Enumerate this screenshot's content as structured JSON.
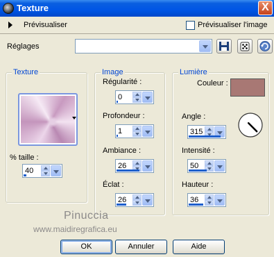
{
  "window": {
    "title": "Texture",
    "close_glyph": "X"
  },
  "preview": {
    "label": "Prévisualiser",
    "apercu_label": "Prévisualiser l'image",
    "apercu_checked": false
  },
  "settings": {
    "label": "Réglages",
    "value": ""
  },
  "texture_group": {
    "title": "Texture",
    "size_label": "% taille :",
    "size_value": "40",
    "size_fraction": 0.08
  },
  "image_group": {
    "title": "Image",
    "fields": [
      {
        "label": "Régularité :",
        "value": "0",
        "fraction": 0.0
      },
      {
        "label": "Profondeur :",
        "value": "1",
        "fraction": 0.03
      },
      {
        "label": "Ambiance :",
        "value": "26",
        "fraction": 0.63
      },
      {
        "label": "Éclat :",
        "value": "26",
        "fraction": 0.26
      }
    ]
  },
  "light_group": {
    "title": "Lumière",
    "color_label": "Couleur :",
    "color_value": "#a87874",
    "fields": [
      {
        "label": "Angle :",
        "value": "315",
        "fraction": 0.88
      },
      {
        "label": "Intensité :",
        "value": "50",
        "fraction": 0.5
      },
      {
        "label": "Hauteur :",
        "value": "36",
        "fraction": 0.4
      }
    ],
    "angle_degrees": 315
  },
  "watermark": {
    "line1": "Pinuccia",
    "line2": "www.maidiregrafica.eu"
  },
  "buttons": {
    "ok": "OK",
    "cancel": "Annuler",
    "help": "Aide"
  },
  "colors": {
    "accent": "#1e5fcc",
    "group_title": "#0046d5"
  }
}
